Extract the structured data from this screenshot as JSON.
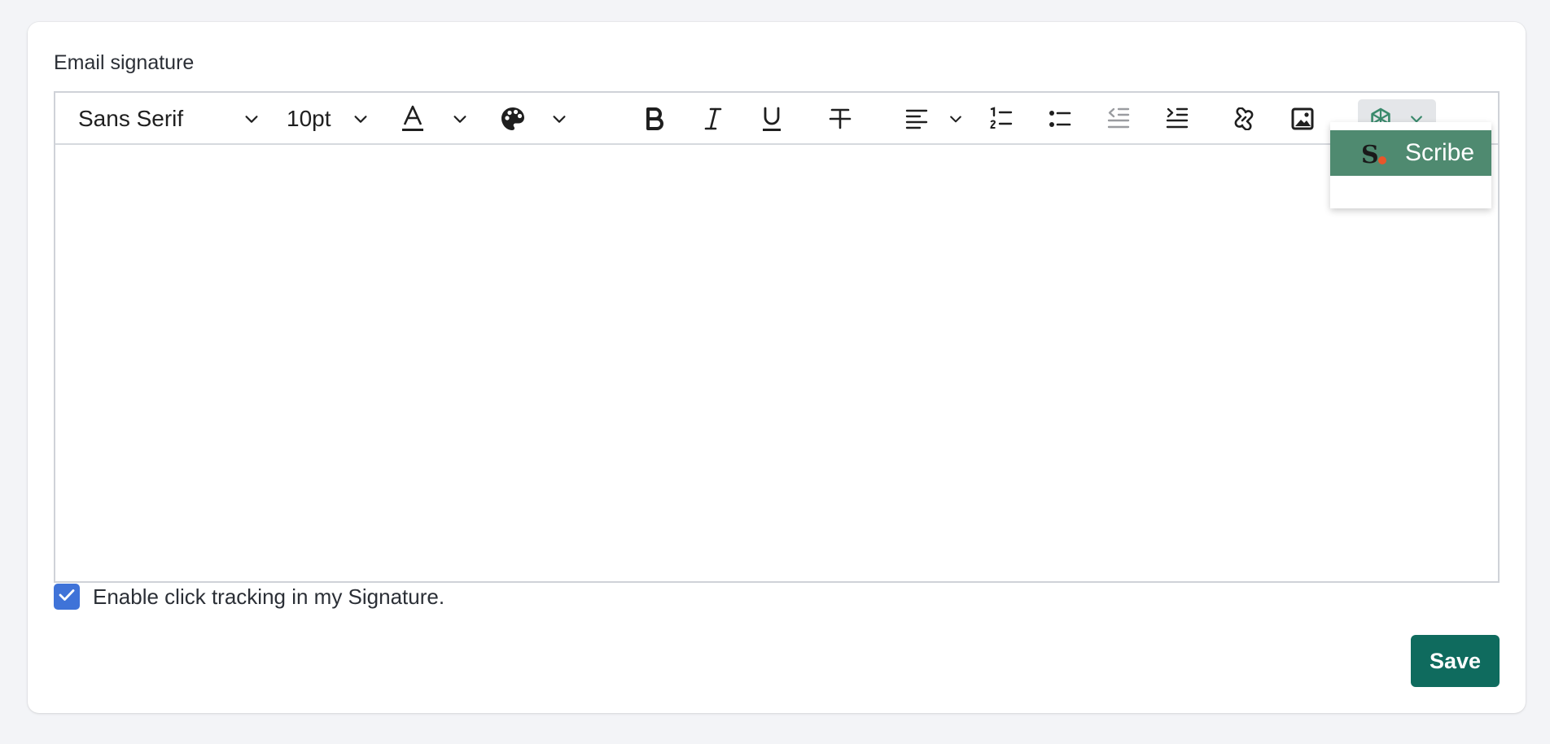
{
  "section": {
    "label": "Email signature"
  },
  "toolbar": {
    "font_family": "Sans Serif",
    "font_size": "10pt"
  },
  "icons": {
    "font_dropdown": "chevron-down-icon",
    "text_color": "text-color-icon",
    "background_color": "palette-icon",
    "bold": "bold-icon",
    "italic": "italic-icon",
    "underline": "underline-icon",
    "strikethrough": "strikethrough-icon",
    "align": "align-left-icon",
    "ordered_list": "ordered-list-icon",
    "bullet_list": "bullet-list-icon",
    "outdent": "outdent-icon",
    "indent": "indent-icon",
    "link": "link-icon",
    "image": "image-icon",
    "calendar": "calendar-icon",
    "integration": "integration-icon"
  },
  "popup": {
    "item_label": "Scribe",
    "logo_letter": "S"
  },
  "tracking": {
    "label": "Enable click tracking in my Signature.",
    "checked": true
  },
  "actions": {
    "save_label": "Save"
  },
  "colors": {
    "save_button": "#0f6b5e",
    "checkbox": "#3f73d8",
    "scribe_item": "#4f8a70",
    "scribe_dot": "#e8562a",
    "integration_icon": "#3a8a6c"
  }
}
